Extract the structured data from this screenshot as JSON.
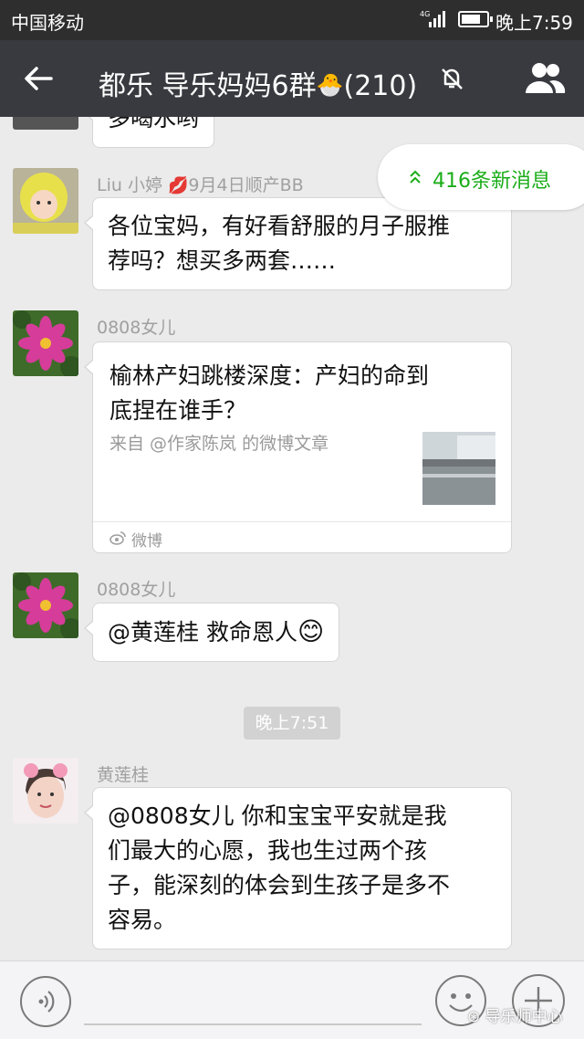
{
  "status": {
    "carrier": "中国移动",
    "time": "晚上7:59",
    "network": "4G"
  },
  "header": {
    "title": "都乐 导乐妈妈6群",
    "count": "(210)",
    "emoji": "🐣"
  },
  "chat": {
    "partial_message": "多喝水哟",
    "new_messages": "416条新消息",
    "messages": [
      {
        "sender": "Liu 小婷",
        "sender_suffix": "9月4日顺产BB",
        "text_lines": [
          "各位宝妈，有好看舒服的月子服推",
          "荐吗？想买多两套……"
        ]
      },
      {
        "sender": "0808女儿",
        "card": {
          "title_lines": [
            "榆林产妇跳楼深度：产妇的命到",
            "底捏在谁手？"
          ],
          "subtitle": "来自 @作家陈岚 的微博文章",
          "source": "微博"
        }
      },
      {
        "sender": "0808女儿",
        "text": "@黄莲桂 救命恩人",
        "emoji": "😊"
      },
      {
        "sender": "黄莲桂",
        "text_lines": [
          "@0808女儿 你和宝宝平安就是我",
          "们最大的心愿，我也生过两个孩",
          "子，能深刻的体会到生孩子是多不",
          "容易。"
        ]
      }
    ],
    "timestamp": "晚上7:51"
  },
  "input_bar": {
    "watermark": "导乐师中心"
  },
  "colors": {
    "status_bar": "#2e2e2e",
    "title_bar": "#393a3f",
    "chat_bg": "#ebebeb",
    "accent_green": "#1aad19",
    "bubble": "#ffffff"
  },
  "icons": [
    "back-arrow-icon",
    "mute-bell-icon",
    "group-people-icon",
    "double-chevron-up-icon",
    "weibo-icon",
    "voice-icon",
    "emoji-icon",
    "plus-icon"
  ]
}
